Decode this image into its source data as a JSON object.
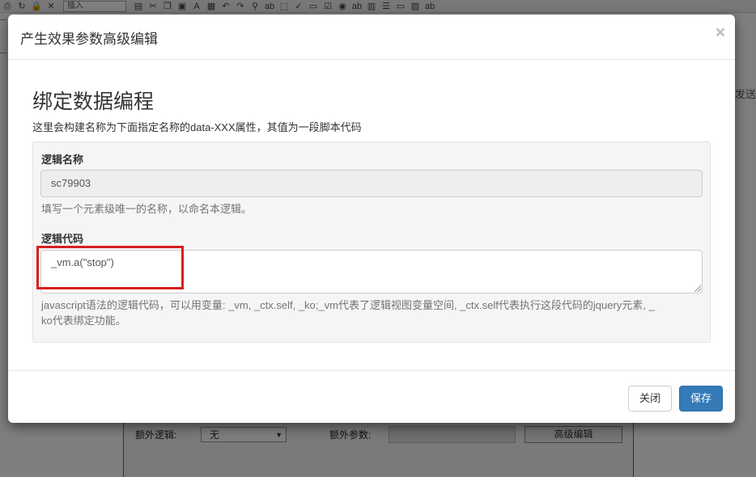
{
  "background": {
    "toolbar": {
      "select_label": "插入",
      "icons": [
        "printer-icon",
        "refresh-icon",
        "lock-icon",
        "close-icon",
        "document-icon",
        "cut-icon",
        "copy-icon",
        "paste-icon",
        "font-icon",
        "image-icon",
        "undo-icon",
        "redo-icon",
        "binoculars-icon",
        "spellcheck-icon",
        "select-icon",
        "checkmark-icon",
        "form-icon",
        "checkbox-icon",
        "radio-icon",
        "textfield-icon",
        "textarea-icon",
        "list-icon",
        "button-icon",
        "image-button-icon",
        "hidden-field-icon"
      ]
    },
    "right_text": "发送",
    "panel": {
      "extra_logic_label": "额外逻辑:",
      "extra_logic_value": "无",
      "extra_params_label": "额外参数:",
      "advanced_button": "高级编辑"
    }
  },
  "modal": {
    "title": "产生效果参数高级编辑",
    "close_symbol": "×",
    "section_title": "绑定数据编程",
    "section_desc": "这里会构建名称为下面指定名称的data-XXX属性，其值为一段脚本代码",
    "logic_name": {
      "label": "逻辑名称",
      "value": "sc79903",
      "help": "填写一个元素级唯一的名称，以命名本逻辑。"
    },
    "logic_code": {
      "label": "逻辑代码",
      "value": "_vm.a(\"stop\")",
      "help_line1": "javascript语法的逻辑代码，可以用变量: _vm, _ctx.self, _ko;_vm代表了逻辑视图变量空间, _ctx.self代表执行这段代码的jquery元素, _",
      "help_line2": "ko代表绑定功能。"
    },
    "footer": {
      "close_label": "关闭",
      "save_label": "保存"
    }
  },
  "colors": {
    "primary": "#337ab7",
    "highlight": "#d81e1e"
  }
}
